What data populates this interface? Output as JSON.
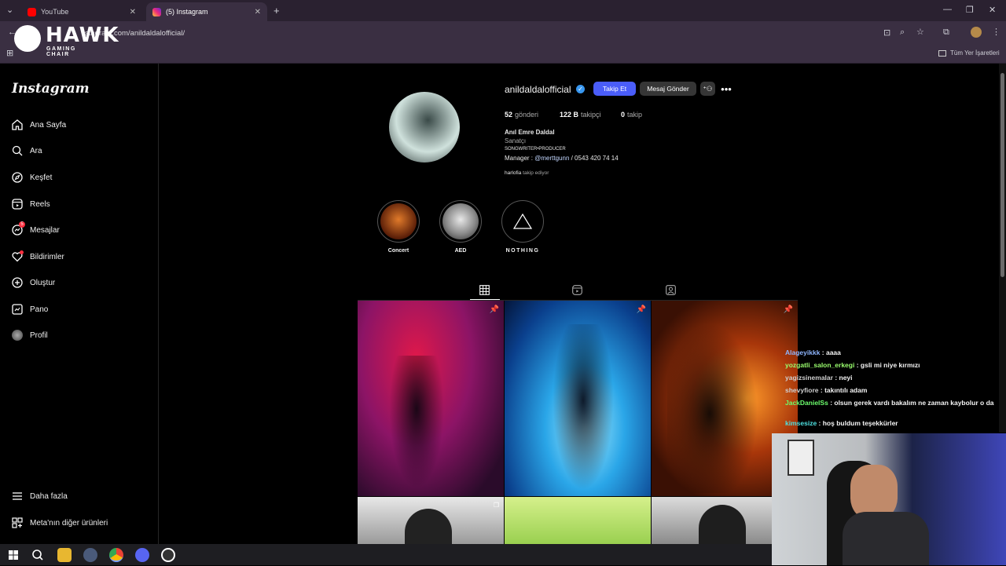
{
  "tabs": [
    {
      "title": "YouTube",
      "color": "#ff0000"
    },
    {
      "title": "(5) Instagram",
      "color": "#d62976"
    }
  ],
  "url": "stagram.com/anildaldalofficial/",
  "bookmarks_label": "Tüm Yer İşaretleri",
  "overlay": {
    "brand": "HAWK",
    "sub": "GAMING CHAIR"
  },
  "sidebar": {
    "logo": "Instagram",
    "items": [
      {
        "label": "Ana Sayfa",
        "icon": "home-icon"
      },
      {
        "label": "Ara",
        "icon": "search-icon"
      },
      {
        "label": "Keşfet",
        "icon": "compass-icon"
      },
      {
        "label": "Reels",
        "icon": "reels-icon"
      },
      {
        "label": "Mesajlar",
        "icon": "messenger-icon",
        "badge": "5"
      },
      {
        "label": "Bildirimler",
        "icon": "heart-icon"
      },
      {
        "label": "Oluştur",
        "icon": "plus-icon"
      },
      {
        "label": "Pano",
        "icon": "dashboard-icon"
      },
      {
        "label": "Profil",
        "icon": "avatar-icon"
      }
    ],
    "bottom": [
      {
        "label": "Daha fazla",
        "icon": "menu-icon"
      },
      {
        "label": "Meta'nın diğer ürünleri",
        "icon": "grid-icon"
      }
    ]
  },
  "profile": {
    "username": "anildaldalofficial",
    "follow_button": "Takip Et",
    "message_button": "Mesaj Gönder",
    "stats": [
      {
        "value": "52",
        "label": "gönderi"
      },
      {
        "value": "122 B",
        "label": "takipçi"
      },
      {
        "value": "0",
        "label": "takip"
      }
    ],
    "name": "Anıl Emre Daldal",
    "category": "Sanatçı",
    "bio1": "SONGWRITER•PRODUCER",
    "bio2_prefix": "Manager : ",
    "bio2_link": "@merttgunn",
    "bio2_suffix": " / 0543 420 74 14",
    "followed_by_user": "harlofia",
    "followed_by_text": " takip ediyor"
  },
  "highlights": [
    {
      "label": "Concert"
    },
    {
      "label": "AED"
    },
    {
      "label": "NOTHING"
    }
  ],
  "chat": [
    {
      "user": "Alageyikkk",
      "msg": " : aaaa",
      "color": "#8fb6ff"
    },
    {
      "user": "yozgatli_salon_erkegi",
      "msg": " : gsli mi niye kırmızı",
      "color": "#9bff6e"
    },
    {
      "user": "yagizsinemalar",
      "msg": " : neyi",
      "color": "#cfcfcf"
    },
    {
      "user": "shevyfiore",
      "msg": " : takıntılı adam",
      "color": "#cfcfcf"
    },
    {
      "user": "JackDanielSs",
      "msg": " : olsun gerek vardı bakalım ne zaman kaybolur o da",
      "color": "#6dff6d"
    },
    {
      "user": "kimsesize",
      "msg": " : hoş buldum teşekkürler",
      "color": "#4ee0e0"
    }
  ],
  "colors": {
    "accent": "#4a5df9",
    "link": "#e0f1ff"
  }
}
